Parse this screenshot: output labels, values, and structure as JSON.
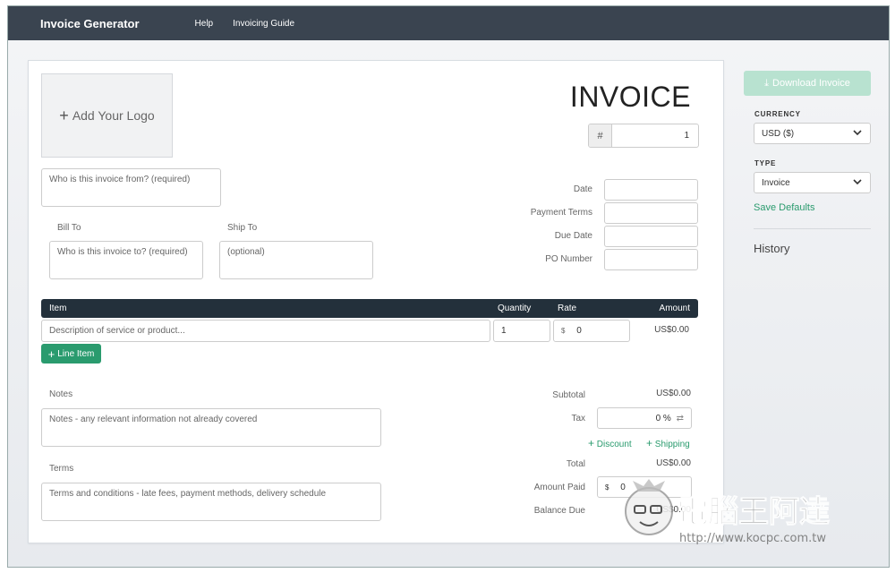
{
  "app": {
    "title": "Invoice Generator"
  },
  "nav": {
    "help": "Help",
    "guide": "Invoicing Guide"
  },
  "invoice": {
    "logo_label": "Add Your Logo",
    "title": "INVOICE",
    "number_prefix": "#",
    "number": "1",
    "from_placeholder": "Who is this invoice from? (required)",
    "bill_to_label": "Bill To",
    "ship_to_label": "Ship To",
    "bill_to_placeholder": "Who is this invoice to? (required)",
    "ship_to_placeholder": "(optional)",
    "meta": {
      "date_label": "Date",
      "payment_terms_label": "Payment Terms",
      "due_date_label": "Due Date",
      "po_number_label": "PO Number"
    },
    "table": {
      "headers": {
        "item": "Item",
        "quantity": "Quantity",
        "rate": "Rate",
        "amount": "Amount"
      },
      "row": {
        "description_placeholder": "Description of service or product...",
        "quantity": "1",
        "currency_symbol": "$",
        "rate": "0",
        "amount": "US$0.00"
      },
      "add_line_label": "Line Item"
    },
    "notes_label": "Notes",
    "notes_placeholder": "Notes - any relevant information not already covered",
    "terms_label": "Terms",
    "terms_placeholder": "Terms and conditions - late fees, payment methods, delivery schedule",
    "totals": {
      "subtotal_label": "Subtotal",
      "subtotal": "US$0.00",
      "tax_label": "Tax",
      "tax_value": "0",
      "tax_unit": "%",
      "discount_label": "Discount",
      "shipping_label": "Shipping",
      "total_label": "Total",
      "total": "US$0.00",
      "amount_paid_label": "Amount Paid",
      "amount_paid_currency": "$",
      "amount_paid": "0",
      "balance_due_label": "Balance Due",
      "balance_due": "US$0.00"
    }
  },
  "sidebar": {
    "download_label": "Download Invoice",
    "currency_caption": "CURRENCY",
    "currency_value": "USD ($)",
    "type_caption": "TYPE",
    "type_value": "Invoice",
    "save_defaults": "Save Defaults",
    "history": "History"
  },
  "watermark": {
    "text": "電腦王阿達",
    "url": "http://www.kocpc.com.tw"
  },
  "colors": {
    "topbar": "#3a4450",
    "accent": "#2a9b6e",
    "table_header": "#23303b",
    "download_disabled": "#b8e2d0"
  }
}
